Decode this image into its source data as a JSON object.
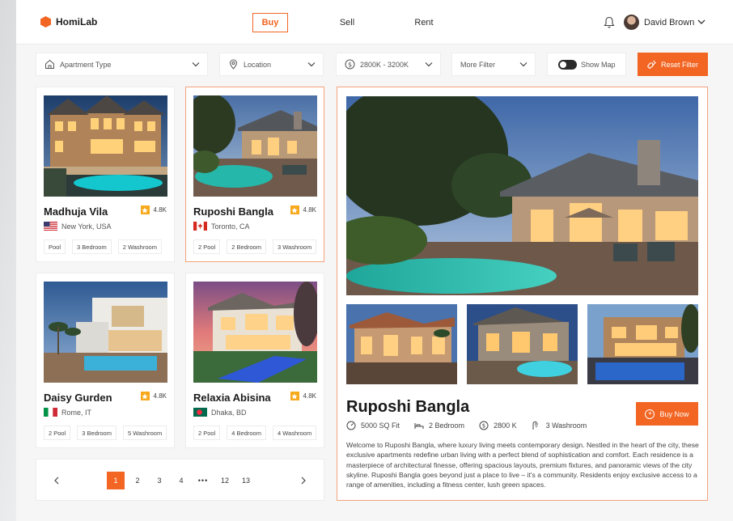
{
  "app": {
    "logo_text": "HomiLab"
  },
  "nav": {
    "buy": "Buy",
    "sell": "Sell",
    "rent": "Rent"
  },
  "user": {
    "name": "David Brown"
  },
  "filters": {
    "type": "Apartment Type",
    "location": "Location",
    "price": "2800K - 3200K",
    "more": "More Filter",
    "map": "Show Map",
    "map_enabled": true,
    "reset": "Reset Filter"
  },
  "colors": {
    "accent": "#f26522",
    "star": "#f7a81b"
  },
  "listings": [
    {
      "name": "Madhuja Vila",
      "rating": "4.8K",
      "location": "New York, USA",
      "flag": "usa-flag",
      "tags": [
        "Pool",
        "3 Bedroom",
        "2 Washroom"
      ]
    },
    {
      "name": "Ruposhi Bangla",
      "rating": "4.8K",
      "location": "Toronto, CA",
      "flag": "canada-flag",
      "tags": [
        "2 Pool",
        "2 Bedroom",
        "3 Washroom"
      ],
      "selected": true
    },
    {
      "name": "Daisy Gurden",
      "rating": "4.8K",
      "location": "Rome, IT",
      "flag": "italy-flag",
      "tags": [
        "2 Pool",
        "3 Bedroom",
        "5 Washroom"
      ]
    },
    {
      "name": "Relaxia Abisina",
      "rating": "4.8K",
      "location": "Dhaka, BD",
      "flag": "bangladesh-flag",
      "tags": [
        "2 Pool",
        "4 Bedroom",
        "4 Washroom"
      ]
    }
  ],
  "pagination": {
    "pages": [
      "1",
      "2",
      "3",
      "4",
      "•••",
      "12",
      "13"
    ],
    "current": "1"
  },
  "detail": {
    "title": "Ruposhi Bangla",
    "buy_label": "Buy Now",
    "specs": {
      "area": "5000 SQ Fit",
      "bedrooms": "2 Bedroom",
      "price": "2800 K",
      "washrooms": "3 Washroom"
    },
    "description": "Welcome to Ruposhi Bangla, where luxury living meets contemporary design. Nestled in the heart of the city, these exclusive apartments redefine urban living with a perfect blend of sophistication and comfort. Each residence is a masterpiece of architectural finesse, offering spacious layouts, premium fixtures, and panoramic views of the city skyline. Ruposhi Bangla goes beyond just a place to live – it's a community. Residents enjoy exclusive access to a range of amenities, including a fitness center, lush green spaces."
  }
}
